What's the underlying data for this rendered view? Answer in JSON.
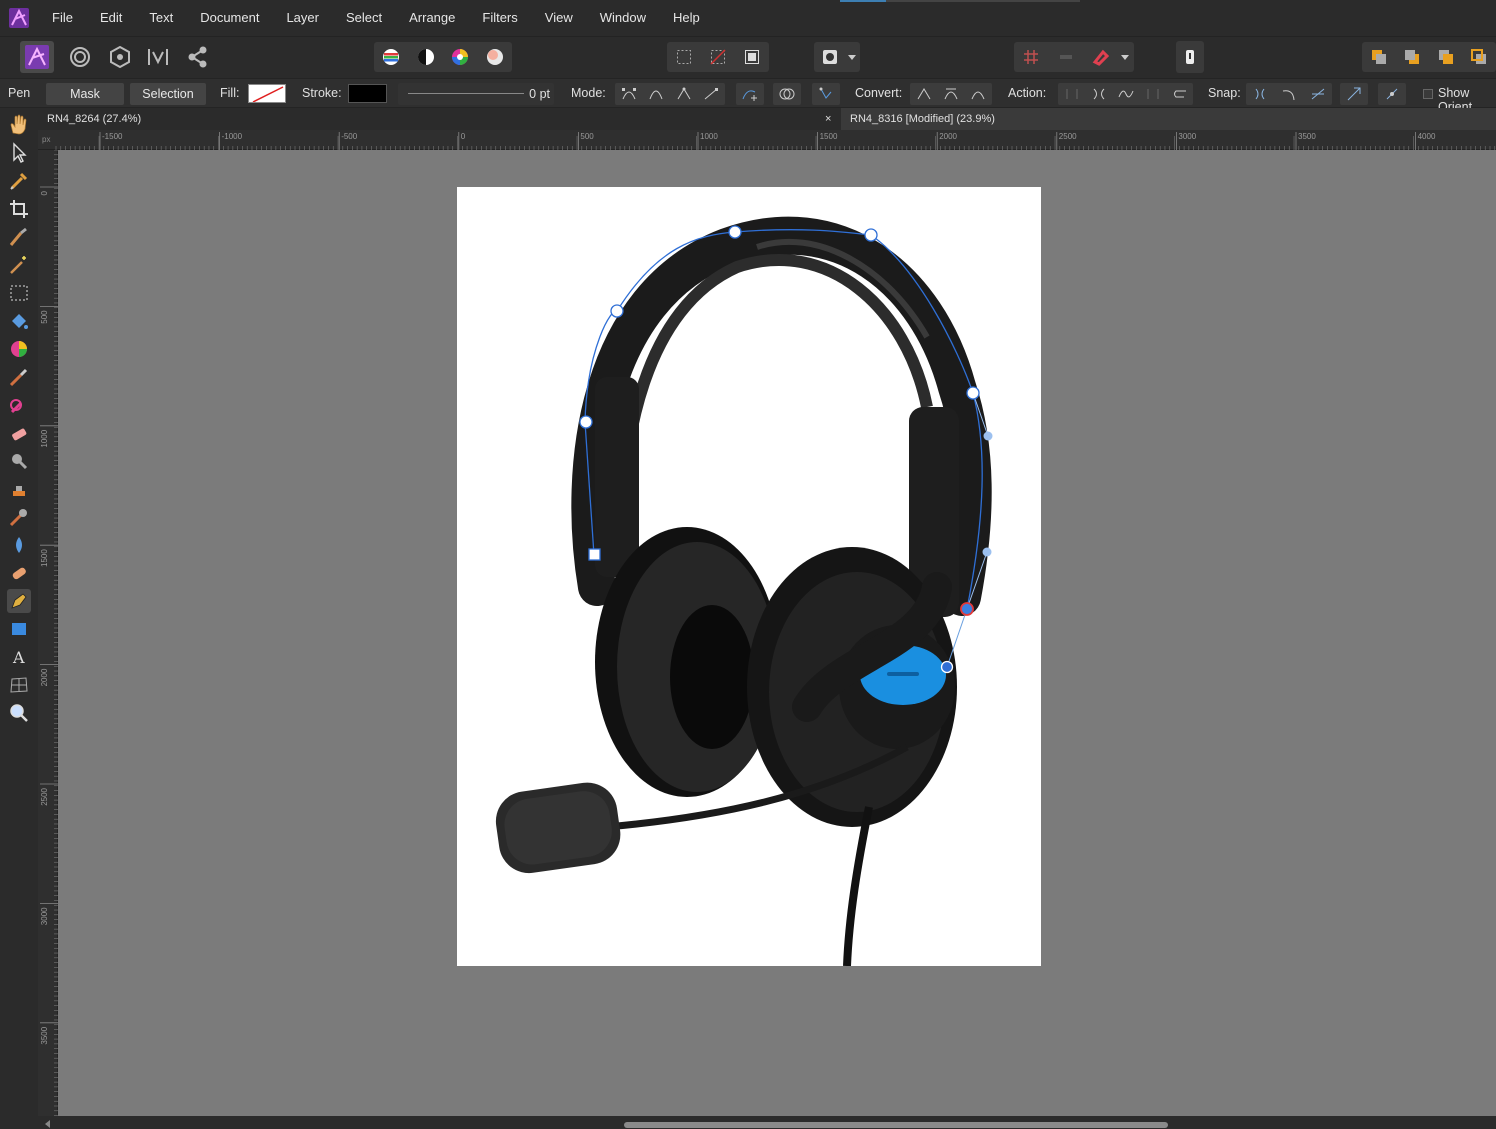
{
  "menubar": {
    "items": [
      "File",
      "Edit",
      "Text",
      "Document",
      "Layer",
      "Select",
      "Arrange",
      "Filters",
      "View",
      "Window",
      "Help"
    ]
  },
  "context": {
    "tool_name": "Pen",
    "mask_label": "Mask",
    "selection_label": "Selection",
    "fill_label": "Fill:",
    "stroke_label": "Stroke:",
    "stroke_width": "0 pt",
    "mode_label": "Mode:",
    "convert_label": "Convert:",
    "action_label": "Action:",
    "snap_label": "Snap:",
    "show_orient_label": "Show Orient"
  },
  "tabs": [
    {
      "title": "RN4_8264 (27.4%)",
      "close": ""
    },
    {
      "title": "RN4_8316 [Modified] (23.9%)",
      "close": "×"
    }
  ],
  "ruler": {
    "unit": "px",
    "top_labels": [
      "-1500",
      "-1000",
      "-500",
      "0",
      "500",
      "1000",
      "1500",
      "2000",
      "2500",
      "3000",
      "3500",
      "4000"
    ],
    "left_labels": [
      "0",
      "500",
      "1000",
      "1500",
      "2000",
      "2500",
      "3000",
      "3500"
    ]
  },
  "colors": {
    "accent": "#3d7fb3",
    "path": "#2f6fd6",
    "headset_accent": "#1a8fe0",
    "selected_node": "#e23a3a"
  },
  "icons": {
    "tools": [
      "hand-icon",
      "move-icon",
      "color-picker-icon",
      "crop-icon",
      "selection-brush-icon",
      "magic-wand-icon",
      "marquee-icon",
      "flood-fill-icon",
      "gradient-icon",
      "paint-brush-icon",
      "pixel-brush-icon",
      "erase-brush-icon",
      "dodge-icon",
      "clone-icon",
      "blemish-icon",
      "blur-icon",
      "healing-icon",
      "pen-icon",
      "rectangle-icon",
      "text-icon",
      "mesh-warp-icon",
      "zoom-icon"
    ]
  }
}
